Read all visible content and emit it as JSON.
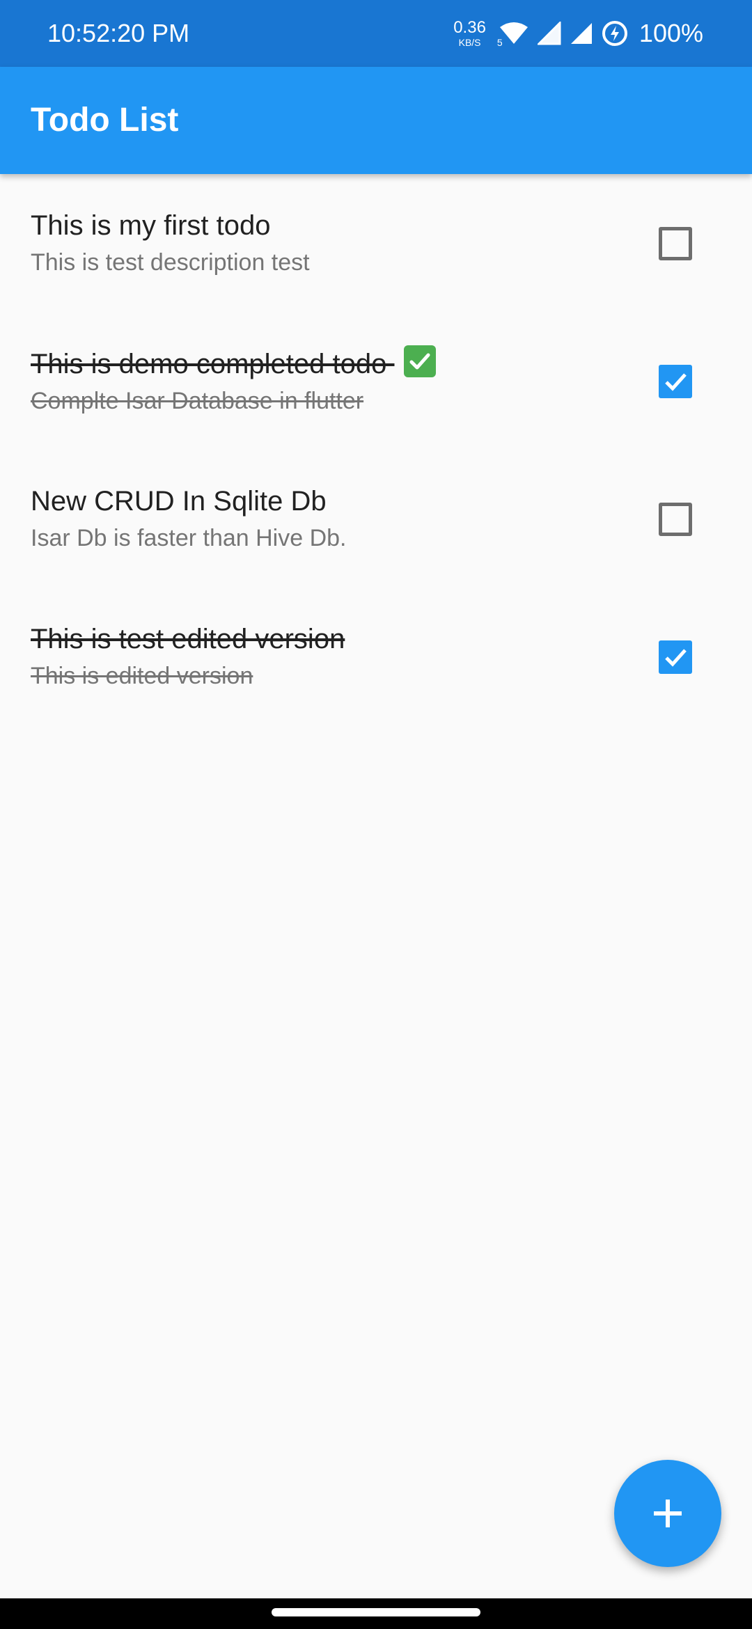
{
  "status_bar": {
    "time": "10:52:20 PM",
    "net_speed_value": "0.36",
    "net_speed_unit": "KB/S",
    "wifi_badge": "5",
    "battery": "100%",
    "icons": [
      "wifi-icon",
      "signal-icon",
      "signal-icon",
      "battery-saver-icon"
    ]
  },
  "app_bar": {
    "title": "Todo List"
  },
  "todos": [
    {
      "title": "This is my first todo",
      "description": "This is test description test",
      "completed": false
    },
    {
      "title": "This is demo completed todo ",
      "title_emoji": "check-mark-button-icon",
      "description": "Complte Isar Database in flutter",
      "completed": true
    },
    {
      "title": "New CRUD In Sqlite Db",
      "description": "Isar Db is faster than Hive Db.",
      "completed": false
    },
    {
      "title": "This is test edited version",
      "description": "This is edited version",
      "completed": true
    }
  ],
  "fab": {
    "icon": "add-icon"
  },
  "colors": {
    "primary": "#2196f3",
    "status_bar": "#1976d2",
    "background": "#fafafa"
  }
}
